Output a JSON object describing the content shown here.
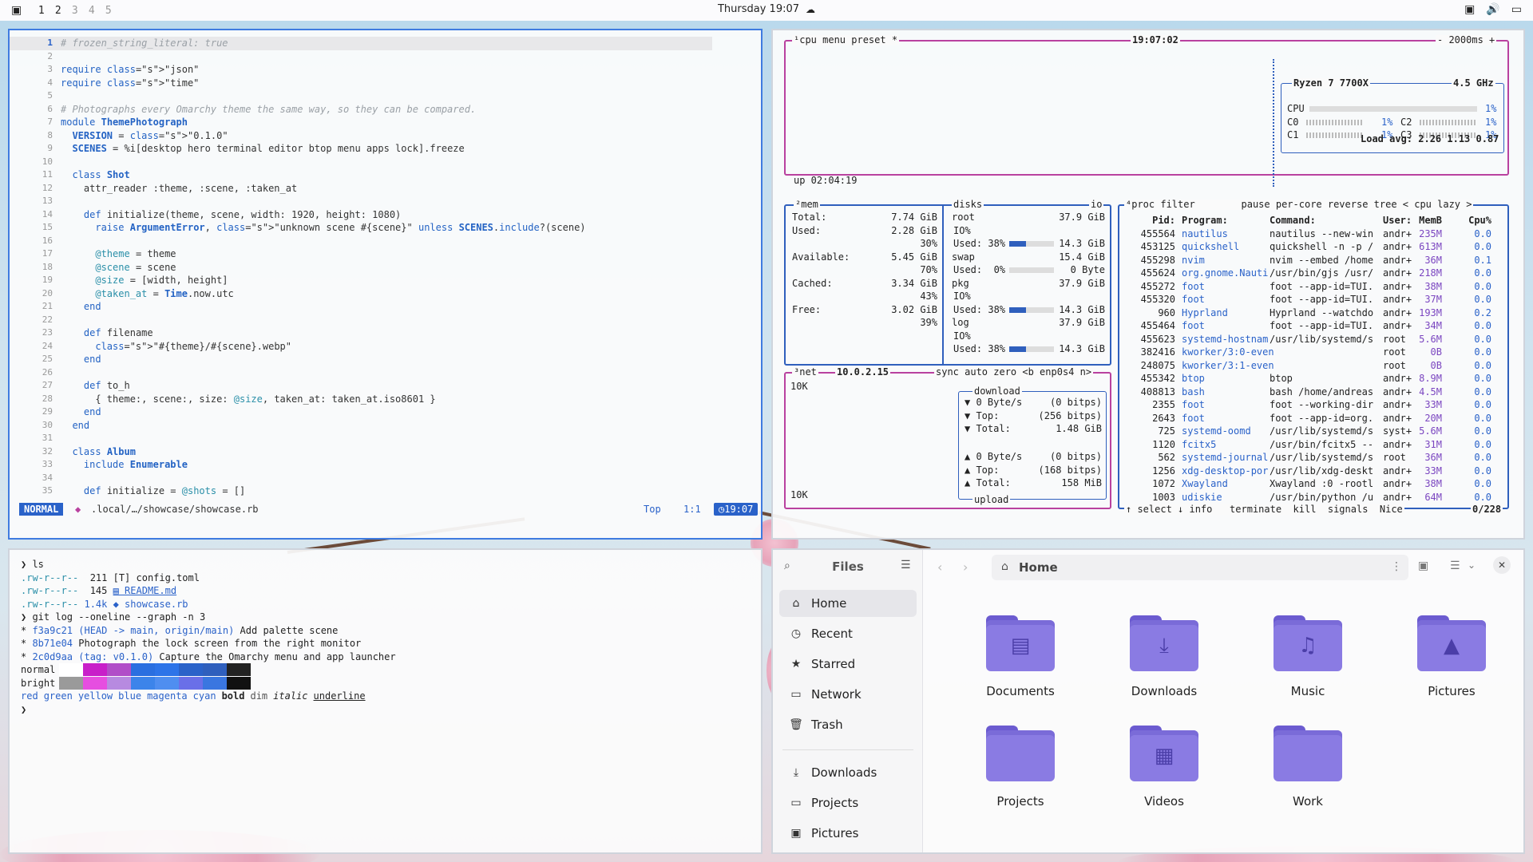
{
  "topbar": {
    "workspaces": [
      "1",
      "2",
      "3",
      "4",
      "5"
    ],
    "clock": "Thursday 19:07"
  },
  "editor": {
    "lines": [
      {
        "n": "1",
        "text": "# frozen_string_literal: true",
        "type": "comment",
        "cur": true
      },
      {
        "n": "2",
        "text": ""
      },
      {
        "n": "3",
        "text": "require \"json\""
      },
      {
        "n": "4",
        "text": "require \"time\""
      },
      {
        "n": "5",
        "text": ""
      },
      {
        "n": "6",
        "text": "# Photographs every Omarchy theme the same way, so they can be compared.",
        "type": "comment"
      },
      {
        "n": "7",
        "text": "module ThemePhotograph"
      },
      {
        "n": "8",
        "text": "  VERSION = \"0.1.0\""
      },
      {
        "n": "9",
        "text": "  SCENES = %i[desktop hero terminal editor btop menu apps lock].freeze"
      },
      {
        "n": "10",
        "text": ""
      },
      {
        "n": "11",
        "text": "  class Shot"
      },
      {
        "n": "12",
        "text": "    attr_reader :theme, :scene, :taken_at"
      },
      {
        "n": "13",
        "text": ""
      },
      {
        "n": "14",
        "text": "    def initialize(theme, scene, width: 1920, height: 1080)"
      },
      {
        "n": "15",
        "text": "      raise ArgumentError, \"unknown scene #{scene}\" unless SCENES.include?(scene)"
      },
      {
        "n": "16",
        "text": ""
      },
      {
        "n": "17",
        "text": "      @theme = theme"
      },
      {
        "n": "18",
        "text": "      @scene = scene"
      },
      {
        "n": "19",
        "text": "      @size = [width, height]"
      },
      {
        "n": "20",
        "text": "      @taken_at = Time.now.utc"
      },
      {
        "n": "21",
        "text": "    end"
      },
      {
        "n": "22",
        "text": ""
      },
      {
        "n": "23",
        "text": "    def filename"
      },
      {
        "n": "24",
        "text": "      \"#{theme}/#{scene}.webp\""
      },
      {
        "n": "25",
        "text": "    end"
      },
      {
        "n": "26",
        "text": ""
      },
      {
        "n": "27",
        "text": "    def to_h"
      },
      {
        "n": "28",
        "text": "      { theme:, scene:, size: @size, taken_at: taken_at.iso8601 }"
      },
      {
        "n": "29",
        "text": "    end"
      },
      {
        "n": "30",
        "text": "  end"
      },
      {
        "n": "31",
        "text": ""
      },
      {
        "n": "32",
        "text": "  class Album"
      },
      {
        "n": "33",
        "text": "    include Enumerable"
      },
      {
        "n": "34",
        "text": ""
      },
      {
        "n": "35",
        "text": "    def initialize = @shots = []"
      }
    ],
    "status": {
      "mode": "NORMAL",
      "file": ".local/…/showcase/showcase.rb",
      "scroll": "Top",
      "pos": "1:1",
      "time": "19:07"
    }
  },
  "btop": {
    "cpu_box": {
      "tabs": "¹cpu menu preset *",
      "clock": "19:07:02",
      "interval": "- 2000ms +",
      "uptime": "up 02:04:19",
      "model": "Ryzen 7 7700X",
      "freq": "4.5 GHz",
      "rows": [
        {
          "label": "CPU",
          "val": "1%"
        },
        {
          "label": "C0",
          "val": "1%",
          "label2": "C2",
          "val2": "1%"
        },
        {
          "label": "C1",
          "val": "1%",
          "label2": "C3",
          "val2": "1%"
        }
      ],
      "load": "Load avg: 2.26 1.13 0.87"
    },
    "mem": {
      "title": "²mem",
      "rows": [
        {
          "label": "Total:",
          "val": "7.74 GiB"
        },
        {
          "label": "Used:",
          "val": "2.28 GiB",
          "pct": "30%"
        },
        {
          "label": "Available:",
          "val": "5.45 GiB",
          "pct": "70%"
        },
        {
          "label": "Cached:",
          "val": "3.34 GiB",
          "pct": "43%"
        },
        {
          "label": "Free:",
          "val": "3.02 GiB",
          "pct": "39%"
        }
      ]
    },
    "disks": {
      "title": "disks",
      "io": "io",
      "items": [
        {
          "name": "root",
          "size": "37.9 GiB",
          "io": "IO%",
          "used": "Used: 38%",
          "usedval": "14.3 GiB",
          "fill": 0.38
        },
        {
          "name": "swap",
          "size": "15.4 GiB",
          "io": "",
          "used": "Used:  0%",
          "usedval": "0 Byte",
          "fill": 0.0
        },
        {
          "name": "pkg",
          "size": "37.9 GiB",
          "io": "IO%",
          "used": "Used: 38%",
          "usedval": "14.3 GiB",
          "fill": 0.38
        },
        {
          "name": "log",
          "size": "37.9 GiB",
          "io": "IO%",
          "used": "Used: 38%",
          "usedval": "14.3 GiB",
          "fill": 0.38
        }
      ]
    },
    "net": {
      "title": "³net",
      "ip": "10.0.2.15",
      "opts": "sync auto zero <b enp0s4 n>",
      "scale_top": "10K",
      "scale_bottom": "10K",
      "download": "download",
      "upload": "upload",
      "down": [
        {
          "k": "▼ 0 Byte/s",
          "v": "(0 bitps)"
        },
        {
          "k": "▼ Top:",
          "v": "(256 bitps)"
        },
        {
          "k": "▼ Total:",
          "v": "1.48 GiB"
        }
      ],
      "up": [
        {
          "k": "▲ 0 Byte/s",
          "v": "(0 bitps)"
        },
        {
          "k": "▲ Top:",
          "v": "(168 bitps)"
        },
        {
          "k": "▲ Total:",
          "v": "158 MiB"
        }
      ]
    },
    "proc": {
      "tabs": "⁴proc filter        pause per-core reverse tree < cpu lazy >",
      "header": {
        "pid": "Pid:",
        "prog": "Program:",
        "cmd": "Command:",
        "user": "User:",
        "mem": "MemB",
        "cpu": "Cpu%"
      },
      "rows": [
        {
          "pid": "455564",
          "prog": "nautilus",
          "cmd": "nautilus --new-win",
          "user": "andr+",
          "mem": "235M",
          "cpu": "0.0"
        },
        {
          "pid": "453125",
          "prog": "quickshell",
          "cmd": "quickshell -n -p /",
          "user": "andr+",
          "mem": "613M",
          "cpu": "0.0"
        },
        {
          "pid": "455298",
          "prog": "nvim",
          "cmd": "nvim --embed /home",
          "user": "andr+",
          "mem": "36M",
          "cpu": "0.1"
        },
        {
          "pid": "455624",
          "prog": "org.gnome.Nauti",
          "cmd": "/usr/bin/gjs /usr/",
          "user": "andr+",
          "mem": "218M",
          "cpu": "0.0"
        },
        {
          "pid": "455272",
          "prog": "foot",
          "cmd": "foot --app-id=TUI.",
          "user": "andr+",
          "mem": "38M",
          "cpu": "0.0"
        },
        {
          "pid": "455320",
          "prog": "foot",
          "cmd": "foot --app-id=TUI.",
          "user": "andr+",
          "mem": "37M",
          "cpu": "0.0"
        },
        {
          "pid": "960",
          "prog": "Hyprland",
          "cmd": "Hyprland --watchdo",
          "user": "andr+",
          "mem": "193M",
          "cpu": "0.2"
        },
        {
          "pid": "455464",
          "prog": "foot",
          "cmd": "foot --app-id=TUI.",
          "user": "andr+",
          "mem": "34M",
          "cpu": "0.0"
        },
        {
          "pid": "455623",
          "prog": "systemd-hostnam",
          "cmd": "/usr/lib/systemd/s",
          "user": "root",
          "mem": "5.6M",
          "cpu": "0.0"
        },
        {
          "pid": "382416",
          "prog": "kworker/3:0-even",
          "cmd": "",
          "user": "root",
          "mem": "0B",
          "cpu": "0.0"
        },
        {
          "pid": "248075",
          "prog": "kworker/3:1-even",
          "cmd": "",
          "user": "root",
          "mem": "0B",
          "cpu": "0.0"
        },
        {
          "pid": "455342",
          "prog": "btop",
          "cmd": "btop",
          "user": "andr+",
          "mem": "8.9M",
          "cpu": "0.0"
        },
        {
          "pid": "408813",
          "prog": "bash",
          "cmd": "bash /home/andreas",
          "user": "andr+",
          "mem": "4.5M",
          "cpu": "0.0"
        },
        {
          "pid": "2355",
          "prog": "foot",
          "cmd": "foot --working-dir",
          "user": "andr+",
          "mem": "33M",
          "cpu": "0.0"
        },
        {
          "pid": "2643",
          "prog": "foot",
          "cmd": "foot --app-id=org.",
          "user": "andr+",
          "mem": "20M",
          "cpu": "0.0"
        },
        {
          "pid": "725",
          "prog": "systemd-oomd",
          "cmd": "/usr/lib/systemd/s",
          "user": "syst+",
          "mem": "5.6M",
          "cpu": "0.0"
        },
        {
          "pid": "1120",
          "prog": "fcitx5",
          "cmd": "/usr/bin/fcitx5 --",
          "user": "andr+",
          "mem": "31M",
          "cpu": "0.0"
        },
        {
          "pid": "562",
          "prog": "systemd-journal",
          "cmd": "/usr/lib/systemd/s",
          "user": "root",
          "mem": "36M",
          "cpu": "0.0"
        },
        {
          "pid": "1256",
          "prog": "xdg-desktop-por",
          "cmd": "/usr/lib/xdg-deskt",
          "user": "andr+",
          "mem": "33M",
          "cpu": "0.0"
        },
        {
          "pid": "1072",
          "prog": "Xwayland",
          "cmd": "Xwayland :0 -rootl",
          "user": "andr+",
          "mem": "38M",
          "cpu": "0.0"
        },
        {
          "pid": "1003",
          "prog": "udiskie",
          "cmd": "/usr/bin/python /u",
          "user": "andr+",
          "mem": "64M",
          "cpu": "0.0"
        }
      ],
      "footer": "↑ select ↓ info   terminate  kill  signals  Nice",
      "count": "0/228"
    }
  },
  "terminal": {
    "lines": [
      {
        "segs": [
          {
            "t": "❯ ",
            "c": "#222"
          },
          {
            "t": "ls",
            "c": "#222"
          }
        ]
      },
      {
        "segs": [
          {
            "t": ".rw-r--r--",
            "c": "#2a8fa8"
          },
          {
            "t": "  211 ",
            "c": "#222"
          },
          {
            "t": "[T] config.toml",
            "c": "#222"
          }
        ]
      },
      {
        "segs": [
          {
            "t": ".rw-r--r--",
            "c": "#2a8fa8"
          },
          {
            "t": "  145 ",
            "c": "#222"
          },
          {
            "t": "▤ README.md",
            "c": "#2a62c9",
            "u": true
          }
        ]
      },
      {
        "segs": [
          {
            "t": ".rw-r--r--",
            "c": "#2a8fa8"
          },
          {
            "t": " 1.4k ",
            "c": "#2a62c9"
          },
          {
            "t": "◆ showcase.rb",
            "c": "#2a62c9"
          }
        ]
      },
      {
        "segs": [
          {
            "t": "❯ ",
            "c": "#222"
          },
          {
            "t": "git log --oneline --graph -n 3",
            "c": "#222"
          }
        ]
      },
      {
        "segs": [
          {
            "t": "* ",
            "c": "#222"
          },
          {
            "t": "f3a9c21 ",
            "c": "#2a62c9"
          },
          {
            "t": "(HEAD -> main, origin/main)",
            "c": "#2a62c9"
          },
          {
            "t": " Add palette scene",
            "c": "#222"
          }
        ]
      },
      {
        "segs": [
          {
            "t": "* ",
            "c": "#222"
          },
          {
            "t": "8b71e04",
            "c": "#2a62c9"
          },
          {
            "t": " Photograph the lock screen from the right monitor",
            "c": "#222"
          }
        ]
      },
      {
        "segs": [
          {
            "t": "* ",
            "c": "#222"
          },
          {
            "t": "2c0d9aa ",
            "c": "#2a62c9"
          },
          {
            "t": "(tag: v0.1.0)",
            "c": "#2a62c9"
          },
          {
            "t": " Capture the Omarchy menu and app launcher",
            "c": "#222"
          }
        ]
      }
    ],
    "palette": {
      "normal_label": "normal",
      "bright_label": "bright",
      "normal": [
        "#ffffff",
        "#c81fc9",
        "#b14ec8",
        "#2a6fe0",
        "#2d74e8",
        "#2a62c9",
        "#2f5fbd",
        "#222222"
      ],
      "bright": [
        "#9a9a9a",
        "#e64ee0",
        "#b78ae0",
        "#3c84ea",
        "#4f8ef0",
        "#6a6fe8",
        "#3a76e0",
        "#111111"
      ]
    },
    "styles": [
      {
        "t": "red",
        "c": "#2a62c9"
      },
      {
        "t": "green",
        "c": "#2a62c9"
      },
      {
        "t": "yellow",
        "c": "#2a62c9"
      },
      {
        "t": "blue",
        "c": "#2a62c9"
      },
      {
        "t": "magenta",
        "c": "#2a62c9"
      },
      {
        "t": "cyan",
        "c": "#2a62c9"
      },
      {
        "t": "bold",
        "c": "#222",
        "b": true
      },
      {
        "t": "dim",
        "c": "#555"
      },
      {
        "t": "italic",
        "c": "#222",
        "i": true
      },
      {
        "t": "underline",
        "c": "#222",
        "u": true
      }
    ],
    "prompt": "❯"
  },
  "files": {
    "title": "Files",
    "location": "Home",
    "sidebar": [
      {
        "label": "Home",
        "icon": "⌂",
        "name": "home"
      },
      {
        "label": "Recent",
        "icon": "◷",
        "name": "recent"
      },
      {
        "label": "Starred",
        "icon": "★",
        "name": "starred"
      },
      {
        "label": "Network",
        "icon": "▭",
        "name": "network"
      },
      {
        "label": "Trash",
        "icon": "🗑",
        "name": "trash"
      }
    ],
    "bookmarks": [
      {
        "label": "Downloads",
        "icon": "⤓",
        "name": "downloads"
      },
      {
        "label": "Projects",
        "icon": "▭",
        "name": "projects"
      },
      {
        "label": "Pictures",
        "icon": "▣",
        "name": "pictures"
      }
    ],
    "folders": [
      {
        "label": "Documents",
        "glyph": "▤"
      },
      {
        "label": "Downloads",
        "glyph": "⤓"
      },
      {
        "label": "Music",
        "glyph": "♫"
      },
      {
        "label": "Pictures",
        "glyph": "▲"
      },
      {
        "label": "Projects",
        "glyph": ""
      },
      {
        "label": "Videos",
        "glyph": "▦"
      },
      {
        "label": "Work",
        "glyph": ""
      }
    ]
  }
}
